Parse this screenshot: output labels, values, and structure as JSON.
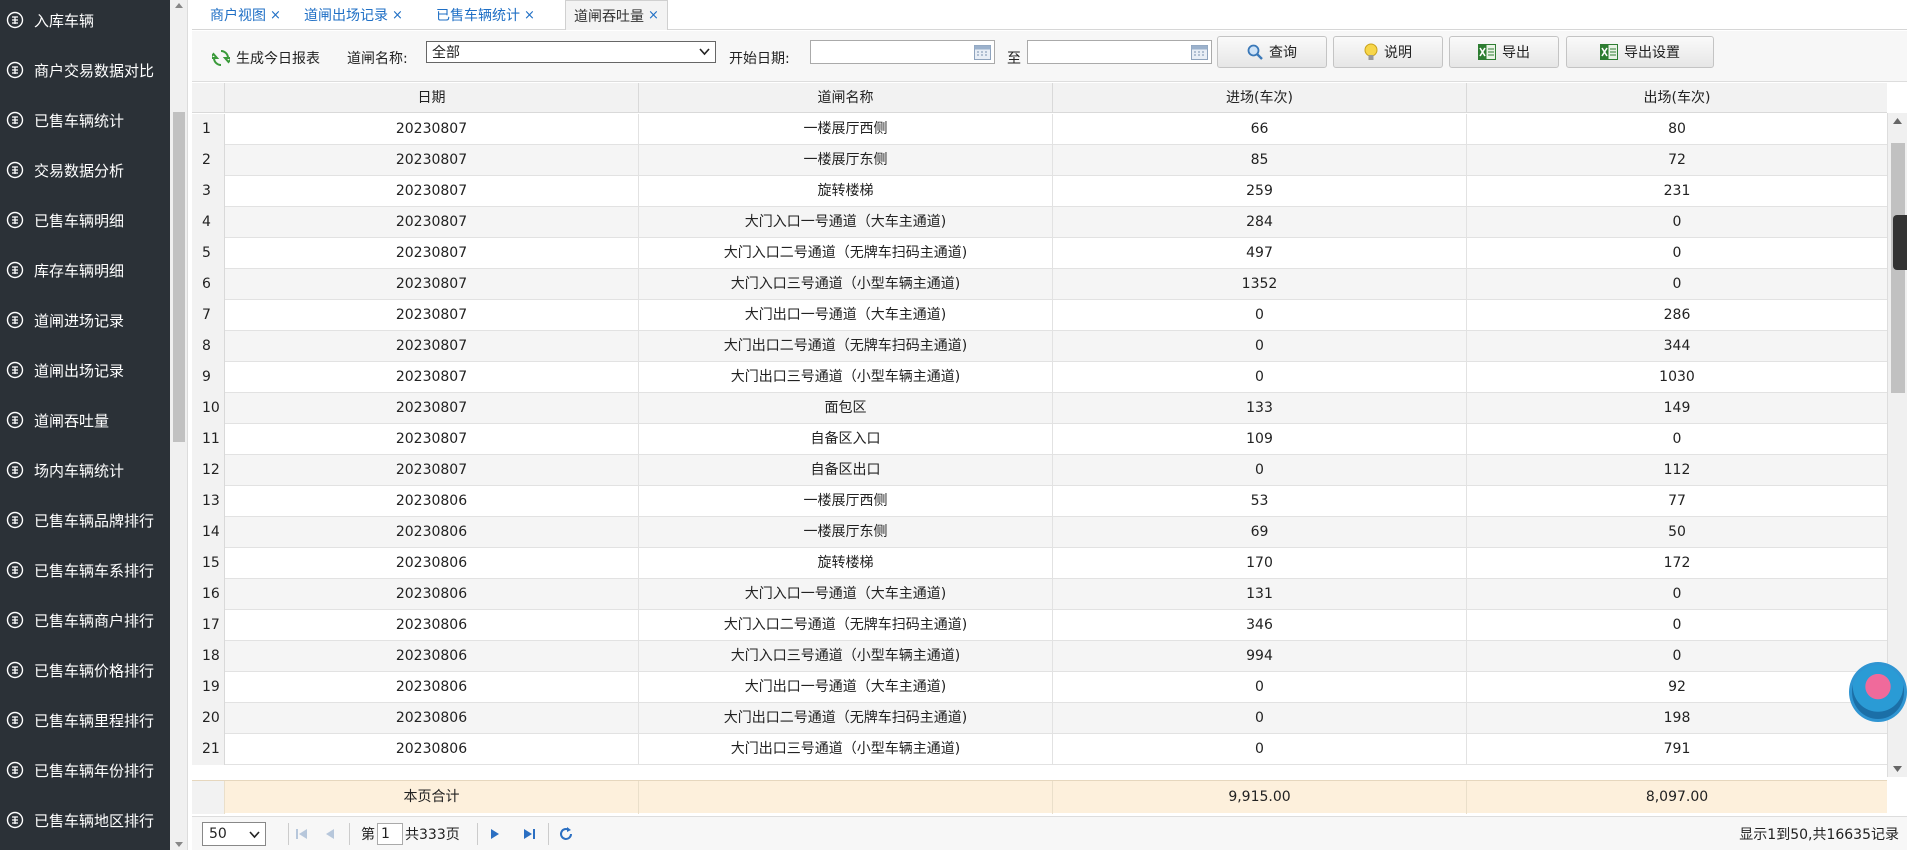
{
  "sidebar": {
    "items": [
      {
        "label": "入库车辆"
      },
      {
        "label": "商户交易数据对比"
      },
      {
        "label": "已售车辆统计"
      },
      {
        "label": "交易数据分析"
      },
      {
        "label": "已售车辆明细"
      },
      {
        "label": "库存车辆明细"
      },
      {
        "label": "道闸进场记录"
      },
      {
        "label": "道闸出场记录"
      },
      {
        "label": "道闸吞吐量"
      },
      {
        "label": "场内车辆统计"
      },
      {
        "label": "已售车辆品牌排行"
      },
      {
        "label": "已售车辆车系排行"
      },
      {
        "label": "已售车辆商户排行"
      },
      {
        "label": "已售车辆价格排行"
      },
      {
        "label": "已售车辆里程排行"
      },
      {
        "label": "已售车辆年份排行"
      },
      {
        "label": "已售车辆地区排行"
      }
    ]
  },
  "tabs": [
    {
      "label": "商户视图",
      "close": "×"
    },
    {
      "label": "道闸出场记录",
      "close": "×"
    },
    {
      "label": "已售车辆统计",
      "close": "×"
    },
    {
      "label": "道闸吞吐量",
      "close": "×"
    }
  ],
  "toolbar": {
    "generate_label": "生成今日报表",
    "gate_label": "道闸名称:",
    "gate_value": "全部",
    "start_date_label": "开始日期:",
    "to_label": "至",
    "start_date_value": "",
    "end_date_value": "",
    "query_label": "查询",
    "help_label": "说明",
    "export_label": "导出",
    "export_settings_label": "导出设置"
  },
  "grid": {
    "columns": [
      "日期",
      "道闸名称",
      "进场(车次)",
      "出场(车次)"
    ],
    "rows": [
      {
        "n": "1",
        "date": "20230807",
        "gate": "一楼展厅西侧",
        "in": "66",
        "out": "80"
      },
      {
        "n": "2",
        "date": "20230807",
        "gate": "一楼展厅东侧",
        "in": "85",
        "out": "72"
      },
      {
        "n": "3",
        "date": "20230807",
        "gate": "旋转楼梯",
        "in": "259",
        "out": "231"
      },
      {
        "n": "4",
        "date": "20230807",
        "gate": "大门入口一号通道（大车主通道)",
        "in": "284",
        "out": "0"
      },
      {
        "n": "5",
        "date": "20230807",
        "gate": "大门入口二号通道（无牌车扫码主通道)",
        "in": "497",
        "out": "0"
      },
      {
        "n": "6",
        "date": "20230807",
        "gate": "大门入口三号通道（小型车辆主通道)",
        "in": "1352",
        "out": "0"
      },
      {
        "n": "7",
        "date": "20230807",
        "gate": "大门出口一号通道（大车主通道)",
        "in": "0",
        "out": "286"
      },
      {
        "n": "8",
        "date": "20230807",
        "gate": "大门出口二号通道（无牌车扫码主通道)",
        "in": "0",
        "out": "344"
      },
      {
        "n": "9",
        "date": "20230807",
        "gate": "大门出口三号通道（小型车辆主通道)",
        "in": "0",
        "out": "1030"
      },
      {
        "n": "10",
        "date": "20230807",
        "gate": "面包区",
        "in": "133",
        "out": "149"
      },
      {
        "n": "11",
        "date": "20230807",
        "gate": "自备区入口",
        "in": "109",
        "out": "0"
      },
      {
        "n": "12",
        "date": "20230807",
        "gate": "自备区出口",
        "in": "0",
        "out": "112"
      },
      {
        "n": "13",
        "date": "20230806",
        "gate": "一楼展厅西侧",
        "in": "53",
        "out": "77"
      },
      {
        "n": "14",
        "date": "20230806",
        "gate": "一楼展厅东侧",
        "in": "69",
        "out": "50"
      },
      {
        "n": "15",
        "date": "20230806",
        "gate": "旋转楼梯",
        "in": "170",
        "out": "172"
      },
      {
        "n": "16",
        "date": "20230806",
        "gate": "大门入口一号通道（大车主通道)",
        "in": "131",
        "out": "0"
      },
      {
        "n": "17",
        "date": "20230806",
        "gate": "大门入口二号通道（无牌车扫码主通道)",
        "in": "346",
        "out": "0"
      },
      {
        "n": "18",
        "date": "20230806",
        "gate": "大门入口三号通道（小型车辆主通道)",
        "in": "994",
        "out": "0"
      },
      {
        "n": "19",
        "date": "20230806",
        "gate": "大门出口一号通道（大车主通道)",
        "in": "0",
        "out": "92"
      },
      {
        "n": "20",
        "date": "20230806",
        "gate": "大门出口二号通道（无牌车扫码主通道)",
        "in": "0",
        "out": "198"
      },
      {
        "n": "21",
        "date": "20230806",
        "gate": "大门出口三号通道（小型车辆主通道)",
        "in": "0",
        "out": "791"
      }
    ],
    "footer": {
      "label": "本页合计",
      "in_total": "9,915.00",
      "out_total": "8,097.00"
    }
  },
  "pager": {
    "page_size": "50",
    "page_prefix": "第",
    "page_value": "1",
    "page_total": "共333页",
    "summary": "显示1到50,共16635记录"
  },
  "colors": {
    "sidebar_bg": "#2b3137",
    "tab_text": "#1f6fc5",
    "footer_bg": "#fdf0dc"
  }
}
